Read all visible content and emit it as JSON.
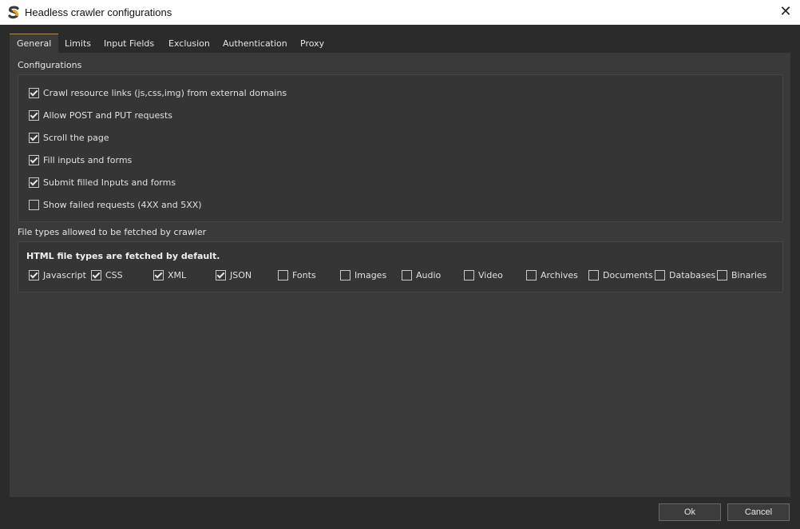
{
  "window": {
    "title": "Headless crawler configurations",
    "close_glyph": "✕",
    "logo_letter": "S"
  },
  "tabs": [
    {
      "label": "General",
      "active": true
    },
    {
      "label": "Limits",
      "active": false
    },
    {
      "label": "Input Fields",
      "active": false
    },
    {
      "label": "Exclusion",
      "active": false
    },
    {
      "label": "Authentication",
      "active": false
    },
    {
      "label": "Proxy",
      "active": false
    }
  ],
  "configurations": {
    "label": "Configurations",
    "options": [
      {
        "label": "Crawl resource links (js,css,img) from external domains",
        "checked": true
      },
      {
        "label": "Allow POST and PUT requests",
        "checked": true
      },
      {
        "label": "Scroll the page",
        "checked": true
      },
      {
        "label": "Fill inputs and forms",
        "checked": true
      },
      {
        "label": "Submit filled Inputs and forms",
        "checked": true
      },
      {
        "label": "Show failed requests (4XX and 5XX)",
        "checked": false
      }
    ]
  },
  "file_types": {
    "label": "File types allowed to be fetched by crawler",
    "note": "HTML file types are fetched by default.",
    "items": [
      {
        "label": "Javascript",
        "checked": true
      },
      {
        "label": "CSS",
        "checked": true
      },
      {
        "label": "XML",
        "checked": true
      },
      {
        "label": "JSON",
        "checked": true
      },
      {
        "label": "Fonts",
        "checked": false
      },
      {
        "label": "Images",
        "checked": false
      },
      {
        "label": "Audio",
        "checked": false
      },
      {
        "label": "Video",
        "checked": false
      },
      {
        "label": "Archives",
        "checked": false
      },
      {
        "label": "Documents",
        "checked": false
      },
      {
        "label": "Databases",
        "checked": false
      },
      {
        "label": "Binaries",
        "checked": false
      }
    ]
  },
  "buttons": {
    "ok": "Ok",
    "cancel": "Cancel"
  },
  "colors": {
    "accent": "#c88a22",
    "logo_orange": "#f0a020",
    "logo_dark": "#3a3a3a"
  }
}
